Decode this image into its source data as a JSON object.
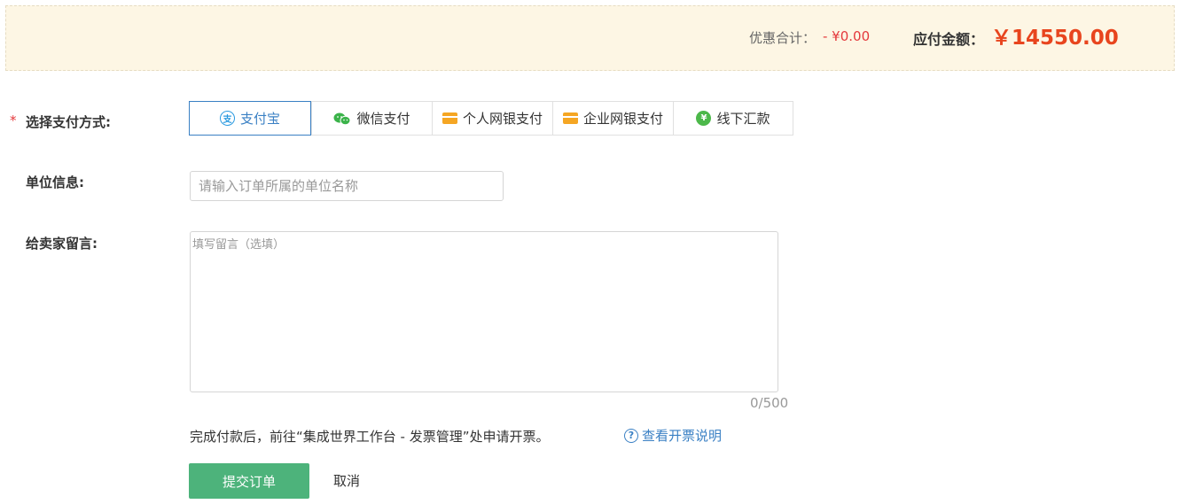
{
  "summary": {
    "discount_label": "优惠合计：",
    "discount_value": "- ¥0.00",
    "payable_label": "应付金额：",
    "payable_value": "￥14550.00"
  },
  "form": {
    "required_mark": "*",
    "payment_label": "选择支付方式:",
    "unit_label": "单位信息:",
    "message_label": "给卖家留言:",
    "unit_placeholder": "请输入订单所属的单位名称",
    "unit_value": "",
    "message_placeholder": "填写留言（选填）",
    "message_value": "",
    "char_count": "0/500"
  },
  "payment_methods": [
    {
      "label": "支付宝",
      "icon": "alipay-icon",
      "selected": true
    },
    {
      "label": "微信支付",
      "icon": "wechat-icon",
      "selected": false
    },
    {
      "label": "个人网银支付",
      "icon": "bank-card-icon",
      "selected": false
    },
    {
      "label": "企业网银支付",
      "icon": "bank-card-icon",
      "selected": false
    },
    {
      "label": "线下汇款",
      "icon": "yuan-icon",
      "selected": false
    }
  ],
  "invoice": {
    "note": "完成付款后，前往“集成世界工作台 - 发票管理”处申请开票。",
    "help_link": "查看开票说明"
  },
  "actions": {
    "submit_label": "提交订单",
    "cancel_label": "取消"
  },
  "colors": {
    "accent": "#3a80c4",
    "price": "#e8451e",
    "submit": "#4db37b",
    "summary_bg": "#fdf6e4"
  }
}
